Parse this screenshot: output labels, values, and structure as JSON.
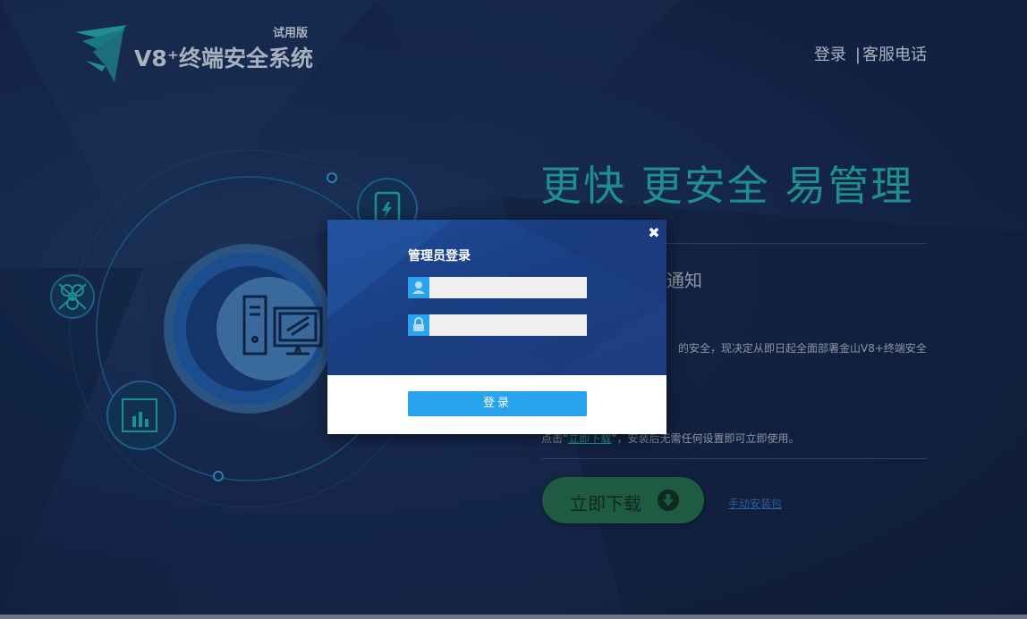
{
  "header": {
    "product_name": "V8⁺终端安全系统",
    "trial_badge": "试用版",
    "nav_login": "登录",
    "nav_separator": "|",
    "nav_support": "客服电话"
  },
  "hero": {
    "slogan": "更快 更安全 易管理",
    "notice_title": "通知",
    "notice_body": "的安全，现决定从即日起全面部署金山V8+终端安全",
    "instruction_prefix": "点击“",
    "instruction_link": "立即下载",
    "instruction_suffix": "”，安装后无需任何设置即可立即使用。",
    "download_button": "立即下载",
    "manual_link": "手动安装包"
  },
  "login_dialog": {
    "title": "管理员登录",
    "close_symbol": "✖",
    "username": {
      "value": "",
      "placeholder": "",
      "icon": "user-icon"
    },
    "password": {
      "value": "",
      "placeholder": "",
      "icon": "lock-icon"
    },
    "submit_label": "登录"
  },
  "colors": {
    "background": "#14264a",
    "slogan_teal": "#1f8e8e",
    "download_green": "#1f5a42",
    "dialog_blue": "#1f4b96",
    "login_button_blue": "#27a2ed"
  }
}
